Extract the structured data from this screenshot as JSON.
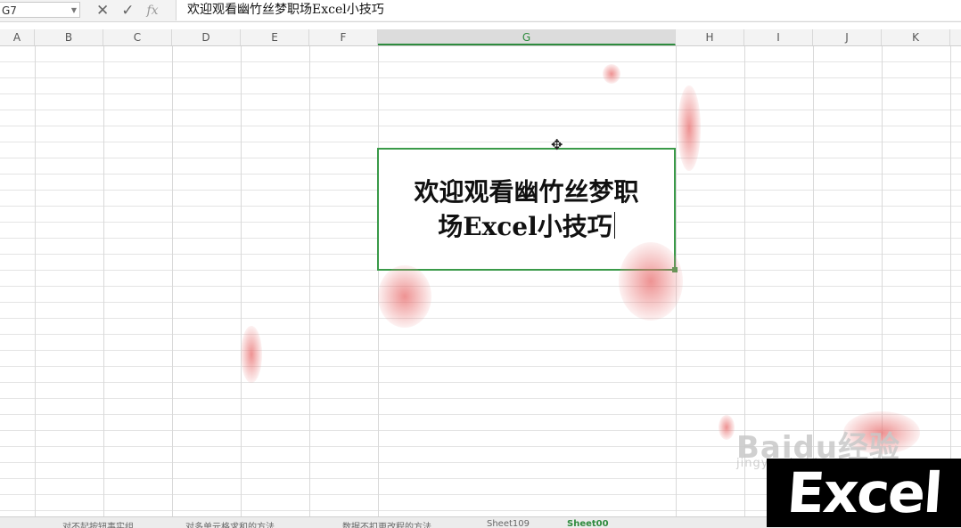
{
  "name_box": {
    "value": "G7"
  },
  "formula_bar": {
    "cancel_icon": "x-icon",
    "enter_icon": "check-icon",
    "fx_label": "fx",
    "value": "欢迎观看幽竹丝梦职场Excel小技巧"
  },
  "columns": [
    "A",
    "B",
    "C",
    "D",
    "E",
    "F",
    "G",
    "H",
    "I",
    "J",
    "K"
  ],
  "active_column": "G",
  "active_cell": {
    "ref": "G7",
    "line1": "欢迎观看幽竹丝梦职",
    "line2": "场Excel小技巧"
  },
  "sheet_tabs": [
    "对不起按钮事实组",
    "对多单元格求和的方法",
    "数据不扣更改程的方法",
    "Sheet109",
    "Sheet00"
  ],
  "active_tab_index": 4,
  "watermark": {
    "text": "Baidu经验",
    "url": "jingyan.baidu.com"
  },
  "logo": {
    "text": "Excel"
  },
  "colors": {
    "accent": "#2e8b3e",
    "petal": "#e86e6e"
  }
}
